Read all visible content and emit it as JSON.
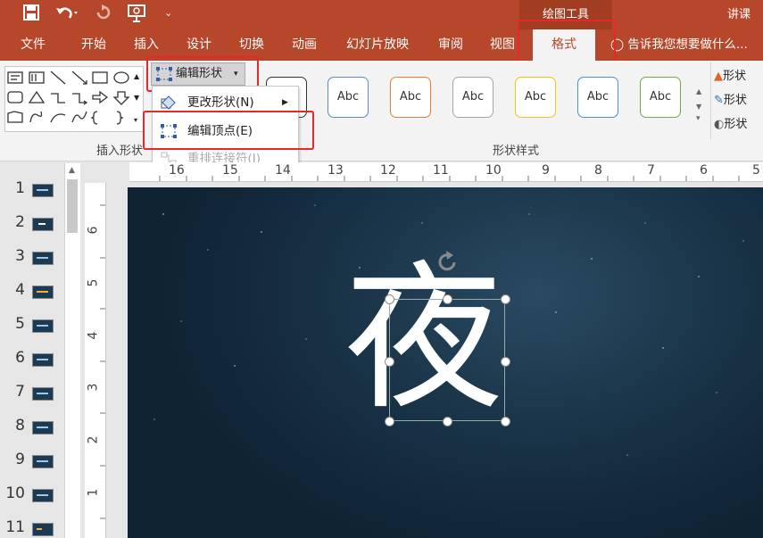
{
  "titlebar": {
    "context_group": "绘图工具",
    "doc_title": "讲课",
    "qat": {
      "save_icon": "save-icon",
      "undo_icon": "undo-icon",
      "redo_icon": "redo-icon",
      "present_icon": "present-icon"
    }
  },
  "tabs": [
    {
      "label": "文件"
    },
    {
      "label": "开始"
    },
    {
      "label": "插入"
    },
    {
      "label": "设计"
    },
    {
      "label": "切换"
    },
    {
      "label": "动画"
    },
    {
      "label": "幻灯片放映"
    },
    {
      "label": "审阅"
    },
    {
      "label": "视图"
    },
    {
      "label": "格式"
    }
  ],
  "active_tab": "格式",
  "tell_me": "告诉我您想要做什么...",
  "ribbon": {
    "edit_shape_label": "编辑形状",
    "insert_shapes_label": "插入形状",
    "shape_styles_label": "形状样式",
    "style_sample": "Abc",
    "right_items": [
      "形状",
      "形状",
      "形状"
    ],
    "style_colors": [
      "#5b8ac6",
      "#ed7d31",
      "#a5a5a5",
      "#f0c419",
      "#4f8fc6",
      "#6dab45"
    ]
  },
  "menu": {
    "items": [
      {
        "label": "更改形状(N)",
        "enabled": true,
        "submenu": true
      },
      {
        "label": "编辑顶点(E)",
        "enabled": true,
        "submenu": false
      },
      {
        "label": "重排连接符(I)",
        "enabled": false,
        "submenu": false
      }
    ]
  },
  "thumbnails": [
    {
      "num": "1"
    },
    {
      "num": "2"
    },
    {
      "num": "3"
    },
    {
      "num": "4"
    },
    {
      "num": "5"
    },
    {
      "num": "6"
    },
    {
      "num": "7"
    },
    {
      "num": "8"
    },
    {
      "num": "9"
    },
    {
      "num": "10"
    },
    {
      "num": "11"
    }
  ],
  "ruler_h": [
    "16",
    "15",
    "14",
    "13",
    "12",
    "11",
    "10",
    "9",
    "8",
    "7",
    "6",
    "5"
  ],
  "ruler_v": [
    "6",
    "5",
    "4",
    "3",
    "2",
    "1"
  ],
  "slide": {
    "text": "夜"
  },
  "colors": {
    "accent": "#b7472a",
    "highlight": "#e8262b"
  }
}
